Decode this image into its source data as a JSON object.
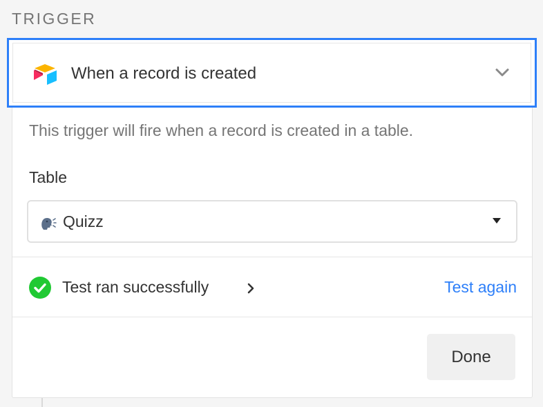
{
  "section": {
    "label": "TRIGGER"
  },
  "trigger": {
    "title": "When a record is created",
    "logo_icon": "airtable-logo",
    "expand_icon": "chevron-down-icon",
    "description": "This trigger will fire when a record is created in a table."
  },
  "table_field": {
    "label": "Table",
    "selected_value": "Quizz",
    "value_icon": "speaking-head-icon",
    "dropdown_icon": "caret-down-icon"
  },
  "test_status": {
    "icon": "check-circle-icon",
    "text": "Test ran successfully",
    "detail_icon": "chevron-right-icon",
    "action_label": "Test again"
  },
  "footer": {
    "done_label": "Done"
  },
  "colors": {
    "accent": "#2d7ff9",
    "success": "#20c933",
    "muted_text": "#757575",
    "text": "#333333"
  }
}
